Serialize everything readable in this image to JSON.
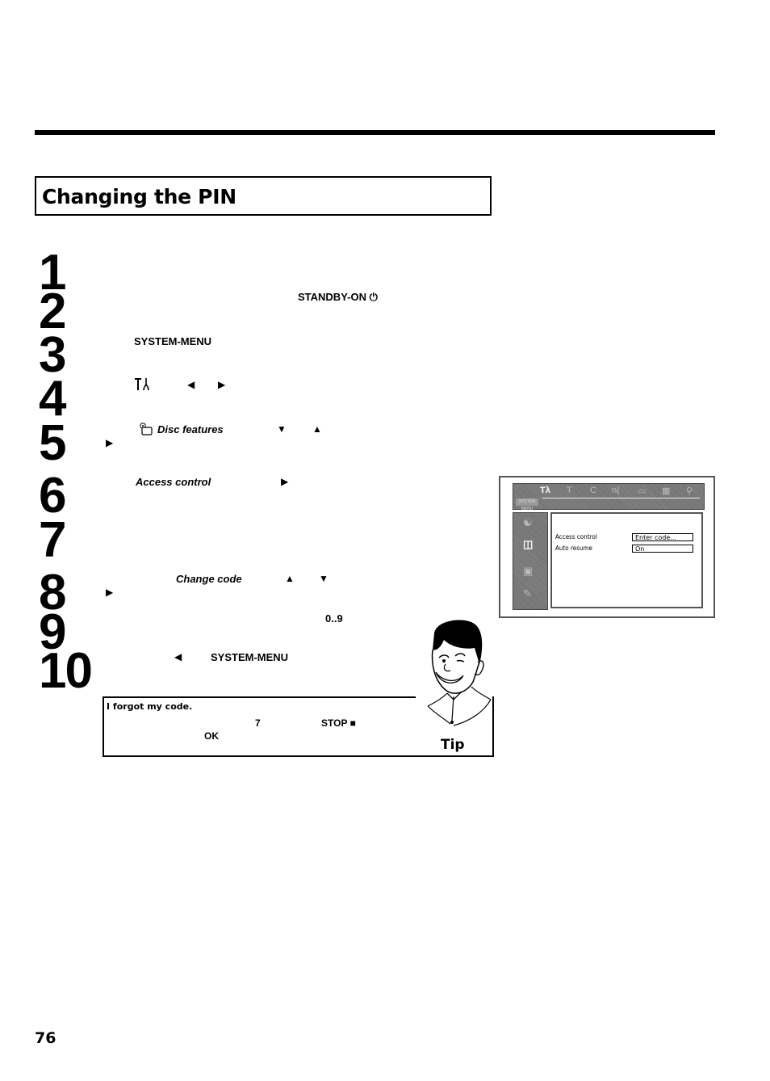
{
  "section_title": "Changing the PIN",
  "steps": [
    {
      "num": "1"
    },
    {
      "num": "2",
      "keys": [
        "STANDBY-ON ⏻"
      ]
    },
    {
      "num": "3",
      "keys": [
        "SYSTEM-MENU"
      ]
    },
    {
      "num": "4",
      "icons": [
        "tools-icon"
      ],
      "arrows": [
        "◀",
        "▶"
      ]
    },
    {
      "num": "5",
      "menu_item": "Disc  features",
      "arrows": [
        "▼",
        "▲",
        "▶"
      ]
    },
    {
      "num": "6",
      "menu_item": "Access control",
      "arrows": [
        "▶"
      ]
    },
    {
      "num": "7"
    },
    {
      "num": "8",
      "menu_item": "Change code",
      "arrows": [
        "▲",
        "▼",
        "▶"
      ]
    },
    {
      "num": "9",
      "keys": [
        "0..9"
      ]
    },
    {
      "num": "10",
      "arrows": [
        "◀"
      ],
      "keys": [
        "SYSTEM-MENU"
      ]
    }
  ],
  "osd": {
    "rows": [
      {
        "label": "Access control",
        "value": "Enter code..."
      },
      {
        "label": "Auto resume",
        "value": "On"
      }
    ],
    "top_icons": [
      "tools-icon",
      "T",
      "C",
      "n(",
      "screen-icon",
      "camera-icon",
      "zoom-icon"
    ],
    "mini_label": "SYSTEM MENU"
  },
  "tip": {
    "title": "I forgot my code.",
    "key_7": "7",
    "key_stop": "STOP ■",
    "key_ok": "OK",
    "label": "Tip"
  },
  "page_number": "76"
}
